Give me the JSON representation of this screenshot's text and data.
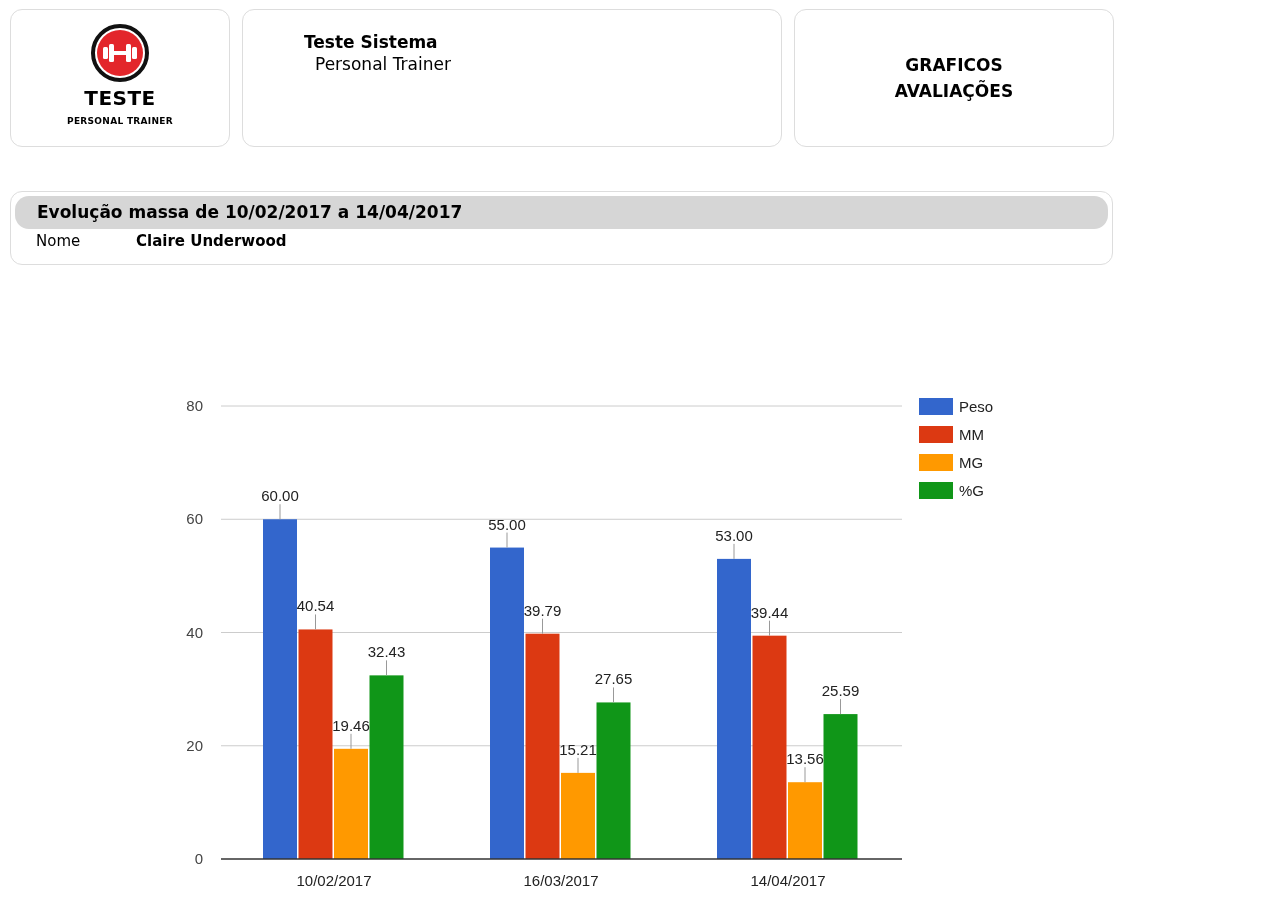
{
  "logo": {
    "title": "TESTE",
    "subtitle": "PERSONAL TRAINER"
  },
  "system": {
    "title": "Teste Sistema",
    "subtitle": "Personal Trainer"
  },
  "page_title": {
    "line_1": "GRAFICOS",
    "line_2": "AVALIAÇÕES"
  },
  "report": {
    "heading": "Evolução massa de 10/02/2017 a 14/04/2017",
    "name_label": "Nome",
    "name_value": "Claire Underwood"
  },
  "chart_data": {
    "type": "bar",
    "categories": [
      "10/02/2017",
      "16/03/2017",
      "14/04/2017"
    ],
    "series": [
      {
        "name": "Peso",
        "color": "#3366cc",
        "values": [
          60.0,
          55.0,
          53.0
        ],
        "value_labels": [
          "60.00",
          "55.00",
          "53.00"
        ]
      },
      {
        "name": "MM",
        "color": "#dc3912",
        "values": [
          40.54,
          39.79,
          39.44
        ],
        "value_labels": [
          "40.54",
          "39.79",
          "39.44"
        ]
      },
      {
        "name": "MG",
        "color": "#ff9900",
        "values": [
          19.46,
          15.21,
          13.56
        ],
        "value_labels": [
          "19.46",
          "15.21",
          "13.56"
        ]
      },
      {
        "name": "%G",
        "color": "#109618",
        "values": [
          32.43,
          27.65,
          25.59
        ],
        "value_labels": [
          "32.43",
          "27.65",
          "25.59"
        ]
      }
    ],
    "ylim": [
      0,
      80
    ],
    "yticks": [
      0,
      20,
      40,
      60,
      80
    ],
    "grid": true,
    "legend": true
  }
}
